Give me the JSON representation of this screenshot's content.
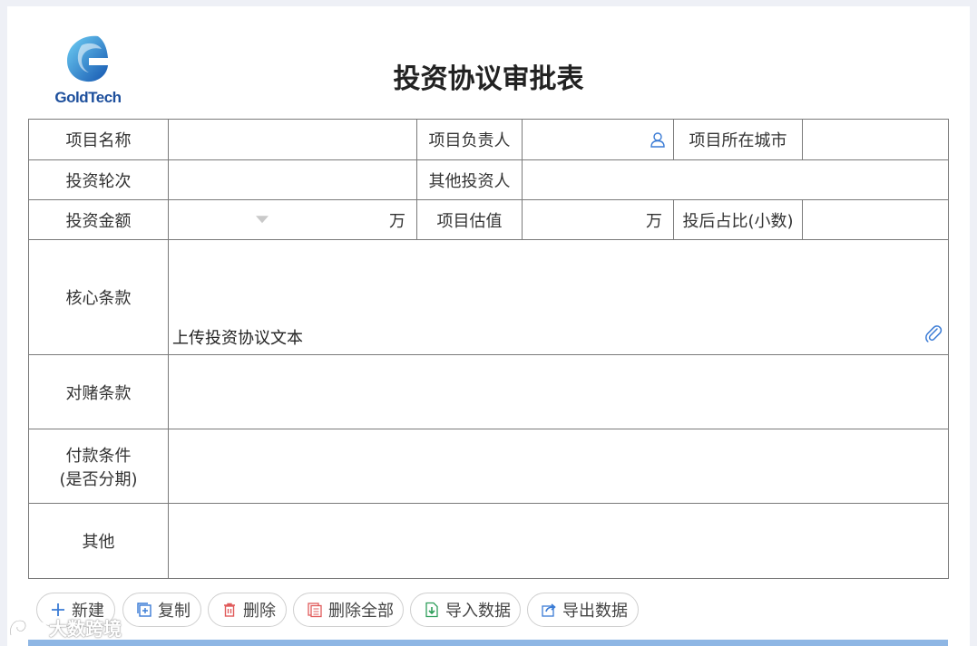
{
  "header": {
    "logo_text": "GoldTech",
    "title": "投资协议审批表"
  },
  "form": {
    "row1": {
      "project_name_label": "项目名称",
      "owner_label": "项目负责人",
      "city_label": "项目所在城市"
    },
    "row2": {
      "round_label": "投资轮次",
      "other_investors_label": "其他投资人"
    },
    "row3": {
      "amount_label": "投资金额",
      "amount_unit": "万",
      "valuation_label": "项目估值",
      "valuation_unit": "万",
      "post_ratio_label": "投后占比(小数)"
    },
    "core_terms": {
      "label": "核心条款",
      "upload_text": "上传投资协议文本"
    },
    "vam_label": "对赌条款",
    "payment": {
      "label_line1": "付款条件",
      "label_line2": "(是否分期)"
    },
    "other_label": "其他"
  },
  "toolbar": {
    "new": "新建",
    "copy": "复制",
    "delete": "删除",
    "delete_all": "删除全部",
    "import": "导入数据",
    "export": "导出数据"
  },
  "watermark": {
    "text": "大数跨境"
  },
  "colors": {
    "accent_blue": "#1d4f9c",
    "bottom_bar": "#8eb6e4",
    "border": "#7a7a7a"
  }
}
